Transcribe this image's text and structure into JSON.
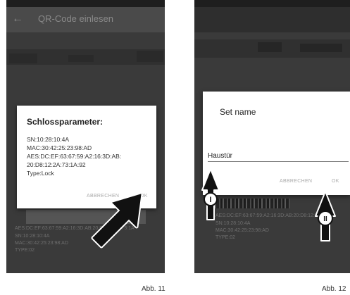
{
  "screen1": {
    "title": "QR-Code einlesen",
    "dialog": {
      "title": "Schlossparameter:",
      "lines": [
        "SN:10:28:10:4A",
        "MAC:30:42:25:23:98:AD",
        "AES:DC:EF:63:67:59:A2:16:3D:AB:",
        "20:D8:12:2A:73:1A:92",
        "Type:Lock"
      ],
      "cancel_label": "ABBRECHEN",
      "ok_label": "OK"
    },
    "background_label": {
      "lines": [
        "AES:DC:EF:63:67:59:A2:16:3D:AB:20:D8:12:2A:73:1A",
        "SN:10:28:10:4A",
        "MAC:30:42:25:23:98:AD",
        "TYPE:02"
      ]
    },
    "caption": "Abb. 11"
  },
  "screen2": {
    "dialog": {
      "title": "Set name",
      "input_value": "Haustür",
      "cancel_label": "ABBRECHEN",
      "ok_label": "OK"
    },
    "background_label": {
      "lines": [
        "AES:DC:EF:63:67:59:A2:16:3D:AB:20:D8:12:2A:73:1A",
        "SN:10:28:10:4A",
        "MAC:30:42:25:23:98:AD",
        "TYPE:02"
      ]
    },
    "markers": [
      "I",
      "II"
    ],
    "caption": "Abb. 12"
  },
  "colors": {
    "dim_background": "#3c3c3c",
    "dialog": "#ffffff",
    "button_text": "#aaaaaa",
    "arrow": "#111111"
  },
  "icons": {
    "back": "arrow-left-icon",
    "pointer": "pointer-arrow-icon"
  }
}
